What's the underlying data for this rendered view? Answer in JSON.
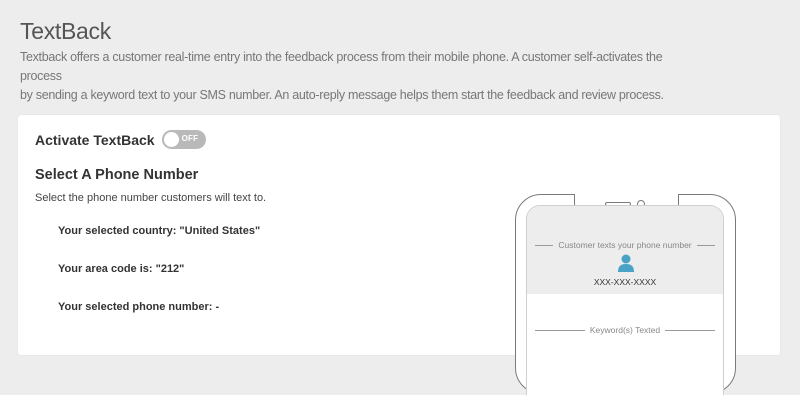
{
  "page": {
    "title": "TextBack",
    "intro_line1": "Textback offers a customer real-time entry into the feedback process from their mobile phone. A customer self-activates the process",
    "intro_line2": "by sending a keyword text to your SMS number. An auto-reply message helps them start the feedback and review process."
  },
  "activate": {
    "label": "Activate TextBack",
    "toggle_text": "OFF",
    "enabled": false
  },
  "phone_section": {
    "title": "Select A Phone Number",
    "description": "Select the phone number customers will text to.",
    "country_text": "Your selected country: \"United States\"",
    "area_code_text": "Your area code is: \"212\"",
    "phone_number_text": "Your selected phone number: -"
  },
  "preview": {
    "top_label": "Customer texts your phone number",
    "phone_placeholder": "XXX-XXX-XXXX",
    "keyword_label": "Keyword(s) Texted",
    "avatar_icon": "user-icon"
  },
  "colors": {
    "background": "#ededed",
    "card": "#ffffff",
    "toggle_off": "#b9b9b9",
    "avatar": "#4aa3c7"
  }
}
